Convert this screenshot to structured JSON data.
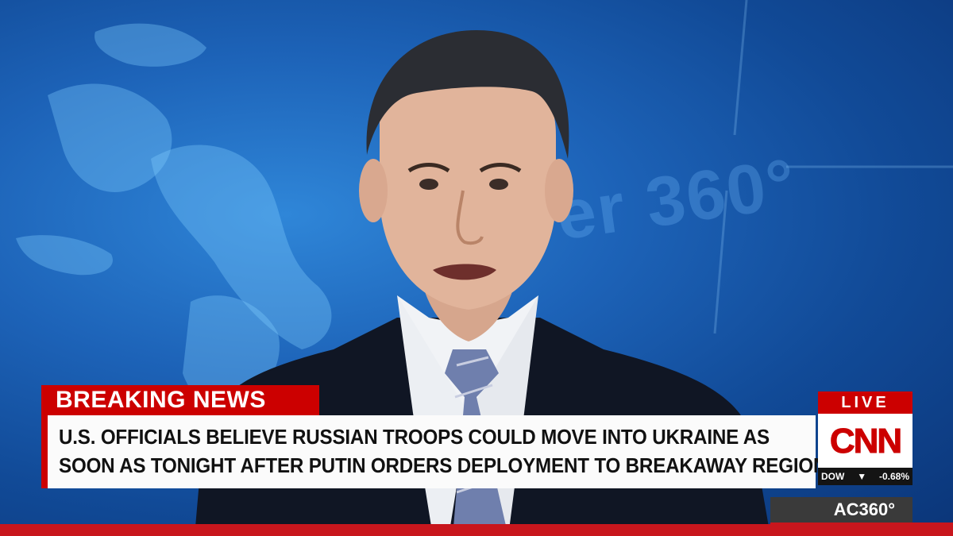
{
  "lower_third": {
    "banner_label": "BREAKING NEWS",
    "headline_lines": [
      "U.S. OFFICIALS BELIEVE RUSSIAN TROOPS COULD MOVE INTO UKRAINE AS",
      "SOON AS TONIGHT AFTER PUTIN ORDERS DEPLOYMENT TO BREAKAWAY REGIONS"
    ]
  },
  "network": {
    "live_label": "LIVE",
    "logo_text": "CNN",
    "ticker": {
      "index": "DOW",
      "direction_icon": "down-triangle-icon",
      "arrow_glyph": "▼",
      "change": "-0.68%"
    },
    "show_name": "AC360°"
  },
  "background_text": "er 360°",
  "colors": {
    "breaking_red": "#cc0000",
    "headline_bg": "#fbfbfb",
    "ticker_bg": "#141414",
    "show_tag_bg": "#3a3a3a",
    "studio_blue": "#1d63b8"
  }
}
